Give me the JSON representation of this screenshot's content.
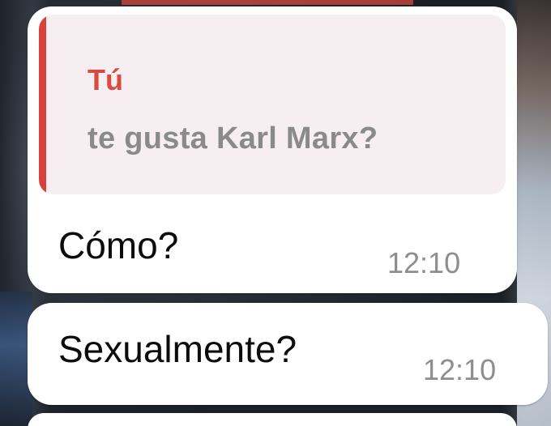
{
  "chat": {
    "messages": [
      {
        "reply_to": {
          "author": "Tú",
          "text": "te gusta  Karl Marx?"
        },
        "text": "Cómo?",
        "time": "12:10"
      },
      {
        "text": "Sexualmente?",
        "time": "12:10"
      }
    ]
  },
  "colors": {
    "quote_accent": "#d8413d",
    "quote_author": "#d84b3f",
    "quote_background": "#f7eef2",
    "bubble_background": "#ffffff",
    "timestamp": "#8e8e8e"
  }
}
